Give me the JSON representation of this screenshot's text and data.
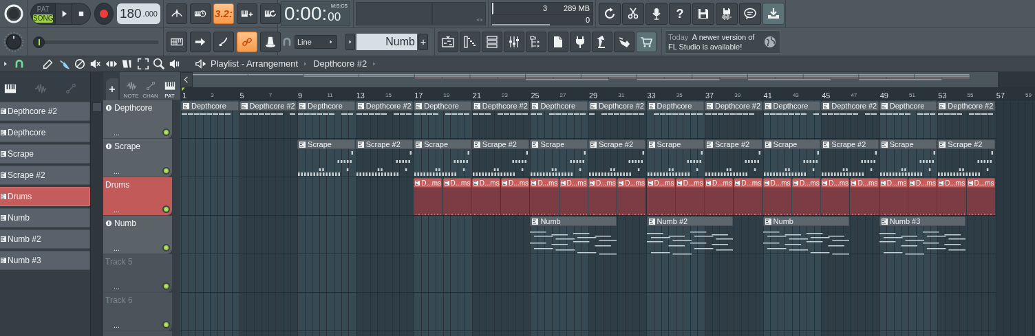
{
  "transport": {
    "modes": [
      {
        "label": "PAT",
        "selected": false
      },
      {
        "label": "SONG",
        "selected": true
      }
    ],
    "tempo": {
      "whole": "180",
      "fraction": ".000"
    }
  },
  "top_tools": [
    {
      "on": false
    },
    {
      "on": false
    },
    {
      "on": true,
      "label": "3.2:"
    },
    {
      "on": false
    },
    {
      "on": false
    }
  ],
  "time": {
    "main": "0:00:",
    "centis": "00",
    "format": "M:S:CS"
  },
  "meters": {
    "polyphony": "3",
    "memory": "289 MB",
    "readout_3": "0"
  },
  "app_buttons": [
    {
      "on": false
    },
    {
      "on": false
    },
    {
      "on": false
    },
    {
      "on": false,
      "label": "?"
    },
    {
      "on": false
    },
    {
      "on": false
    },
    {
      "on": false
    },
    {
      "on": true
    }
  ],
  "position_slider": {
    "level": 0.0
  },
  "edit_buttons": [
    {
      "on": false
    },
    {
      "on": false
    },
    {
      "on": false
    },
    {
      "on": true
    },
    {
      "on": false
    }
  ],
  "snap": {
    "value": "Line"
  },
  "pattern_selector": {
    "value": "Numb",
    "add": "+"
  },
  "window_buttons": [
    {
      "on": false
    },
    {
      "on": false
    },
    {
      "on": false
    },
    {
      "on": false
    },
    {
      "on": false
    },
    {
      "on": false
    },
    {
      "on": false
    },
    {
      "on": false
    },
    {
      "on": false
    },
    {
      "on": true
    }
  ],
  "news": {
    "when": "Today",
    "message": "A newer version of FL Studio is available!"
  },
  "playlist_magnet": {
    "on": true
  },
  "breadcrumb": [
    "Playlist - Arrangement",
    "Depthcore #2"
  ],
  "picker_tabs": [
    {
      "selected": true
    },
    {
      "selected": false
    },
    {
      "selected": false
    }
  ],
  "header_tabs": {
    "add": "+",
    "tabs": [
      {
        "label": "NOTE",
        "selected": false
      },
      {
        "label": "CHAN",
        "selected": false
      },
      {
        "label": "PAT",
        "selected": true
      }
    ]
  },
  "patterns": [
    {
      "label": "Depthcore #2",
      "selected": false
    },
    {
      "label": "Depthcore",
      "selected": false
    },
    {
      "label": "Scrape",
      "selected": false
    },
    {
      "label": "Scrape #2",
      "selected": false
    },
    {
      "label": "Drums",
      "selected": true
    },
    {
      "label": "Numb",
      "selected": false
    },
    {
      "label": "Numb #2",
      "selected": false
    },
    {
      "label": "Numb #3",
      "selected": false
    }
  ],
  "ruler": [
    {
      "text": "1",
      "major": true
    },
    {
      "text": "3",
      "major": false
    },
    {
      "text": "5",
      "major": true
    },
    {
      "text": "7",
      "major": false
    },
    {
      "text": "9",
      "major": true
    },
    {
      "text": "11",
      "major": false
    },
    {
      "text": "13",
      "major": true
    },
    {
      "text": "15",
      "major": false
    },
    {
      "text": "17",
      "major": true
    },
    {
      "text": "19",
      "major": false
    },
    {
      "text": "21",
      "major": true
    },
    {
      "text": "23",
      "major": false
    },
    {
      "text": "25",
      "major": true
    },
    {
      "text": "27",
      "major": false
    },
    {
      "text": "29",
      "major": true
    },
    {
      "text": "31",
      "major": false
    },
    {
      "text": "33",
      "major": true
    },
    {
      "text": "35",
      "major": false
    },
    {
      "text": "37",
      "major": true
    },
    {
      "text": "39",
      "major": false
    },
    {
      "text": "41",
      "major": true
    },
    {
      "text": "43",
      "major": false
    },
    {
      "text": "45",
      "major": true
    },
    {
      "text": "47",
      "major": false
    },
    {
      "text": "49",
      "major": true
    },
    {
      "text": "51",
      "major": false
    },
    {
      "text": "53",
      "major": true
    },
    {
      "text": "55",
      "major": false
    },
    {
      "text": "57",
      "major": true
    },
    {
      "text": "59",
      "major": false
    }
  ],
  "tracks": [
    {
      "label": "Depthcore",
      "menu": "...",
      "empty": false,
      "selected": false,
      "kind": "melody",
      "clips": [
        {
          "kind": "pattern",
          "label": "Depthcore"
        },
        {
          "kind": "pattern",
          "label": "Depthcore #2"
        },
        {
          "kind": "pattern",
          "label": "Depthcore"
        },
        {
          "kind": "pattern",
          "label": "Depthcore #2"
        },
        {
          "kind": "pattern",
          "label": "Depthcore"
        },
        {
          "kind": "pattern",
          "label": "Depthcore #2"
        },
        {
          "kind": "pattern",
          "label": "Depthcore"
        },
        {
          "kind": "pattern",
          "label": "Depthcore #2"
        },
        {
          "kind": "pattern",
          "label": "Depthcore"
        },
        {
          "kind": "pattern",
          "label": "Depthcore #2"
        },
        {
          "kind": "pattern",
          "label": "Depthcore"
        },
        {
          "kind": "pattern",
          "label": "Depthcore #2"
        },
        {
          "kind": "pattern",
          "label": "Depthcore"
        },
        {
          "kind": "pattern",
          "label": "Depthcore #2"
        }
      ]
    },
    {
      "label": "Scrape",
      "menu": "...",
      "empty": false,
      "selected": false,
      "kind": "steps",
      "clips": [
        {
          "kind": "gap"
        },
        {
          "kind": "gap"
        },
        {
          "kind": "gap"
        },
        {
          "kind": "gap"
        },
        {
          "kind": "pattern",
          "label": "Scrape"
        },
        {
          "kind": "pattern",
          "label": "Scrape #2"
        },
        {
          "kind": "pattern",
          "label": "Scrape"
        },
        {
          "kind": "pattern",
          "label": "Scrape #2"
        },
        {
          "kind": "pattern",
          "label": "Scrape"
        },
        {
          "kind": "pattern",
          "label": "Scrape #2"
        },
        {
          "kind": "pattern",
          "label": "Scrape"
        },
        {
          "kind": "pattern",
          "label": "Scrape #2"
        },
        {
          "kind": "pattern",
          "label": "Scrape"
        },
        {
          "kind": "pattern",
          "label": "Scrape #2"
        },
        {
          "kind": "pattern",
          "label": "Scrape"
        },
        {
          "kind": "pattern",
          "label": "Scrape #2"
        }
      ]
    },
    {
      "label": "Drums",
      "menu": "...",
      "empty": false,
      "selected": true,
      "kind": "drums",
      "clips": [
        {
          "kind": "gap"
        },
        {
          "kind": "gap"
        },
        {
          "kind": "gap"
        },
        {
          "kind": "gap"
        },
        {
          "kind": "gap"
        },
        {
          "kind": "gap"
        },
        {
          "kind": "gap"
        },
        {
          "kind": "gap"
        },
        {
          "kind": "pattern",
          "label": "D...ms"
        },
        {
          "kind": "pattern",
          "label": "D...ms"
        },
        {
          "kind": "pattern",
          "label": "D...ms"
        },
        {
          "kind": "pattern",
          "label": "D...ms"
        },
        {
          "kind": "pattern",
          "label": "D...ms"
        },
        {
          "kind": "pattern",
          "label": "D...ms"
        },
        {
          "kind": "pattern",
          "label": "D...ms"
        },
        {
          "kind": "pattern",
          "label": "D...ms"
        },
        {
          "kind": "pattern",
          "label": "D...ms"
        },
        {
          "kind": "pattern",
          "label": "D...ms"
        },
        {
          "kind": "pattern",
          "label": "D...ms"
        },
        {
          "kind": "pattern",
          "label": "D...ms"
        },
        {
          "kind": "pattern",
          "label": "D...ms"
        },
        {
          "kind": "pattern",
          "label": "D...ms"
        },
        {
          "kind": "pattern",
          "label": "D...ms"
        },
        {
          "kind": "pattern",
          "label": "D...ms"
        },
        {
          "kind": "pattern",
          "label": "D...ms"
        },
        {
          "kind": "pattern",
          "label": "D...ms"
        },
        {
          "kind": "pattern",
          "label": "D...ms"
        },
        {
          "kind": "pattern",
          "label": "D...ms"
        }
      ]
    },
    {
      "label": "Numb",
      "menu": "...",
      "empty": false,
      "selected": false,
      "kind": "chords",
      "clips": [
        {
          "kind": "gap"
        },
        {
          "kind": "gap"
        },
        {
          "kind": "gap"
        },
        {
          "kind": "gap"
        },
        {
          "kind": "gap"
        },
        {
          "kind": "gap"
        },
        {
          "kind": "gap"
        },
        {
          "kind": "gap"
        },
        {
          "kind": "gap"
        },
        {
          "kind": "gap"
        },
        {
          "kind": "gap"
        },
        {
          "kind": "gap"
        },
        {
          "kind": "pattern",
          "label": "Numb"
        },
        {
          "kind": "gap"
        },
        {
          "kind": "pattern",
          "label": "Numb #2"
        },
        {
          "kind": "gap"
        },
        {
          "kind": "pattern",
          "label": "Numb"
        },
        {
          "kind": "gap"
        },
        {
          "kind": "pattern",
          "label": "Numb #3"
        }
      ]
    },
    {
      "label": "Track 5",
      "menu": "...",
      "empty": true,
      "selected": false
    },
    {
      "label": "Track 6",
      "menu": "...",
      "empty": true,
      "selected": false
    },
    {
      "empty": true,
      "selected": false
    }
  ]
}
